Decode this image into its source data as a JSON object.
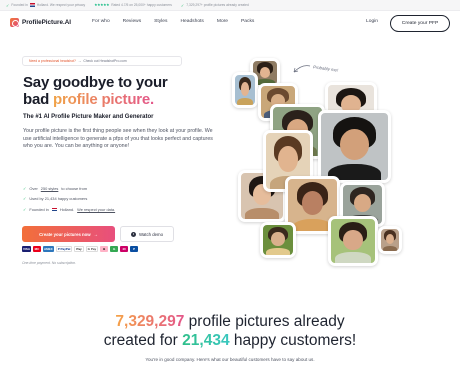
{
  "topbar": {
    "founded": "Founded in",
    "country": "Holland. We respect your privacy",
    "rating": "Rated 4.7/5 on 25,000+ happy customers",
    "created": "7,329,297+ profile pictures already created"
  },
  "nav": {
    "logo": "ProfilePicture.AI",
    "links": [
      "For who",
      "Reviews",
      "Styles",
      "Headshots",
      "More",
      "Packs"
    ],
    "login": "Login",
    "cta": "Create your PFP"
  },
  "banner": {
    "highlight": "Need a professional headshot?",
    "rest": "Check out HeadshotPro.com"
  },
  "hero": {
    "title_line1": "Say goodbye to your",
    "title_pre": "bad ",
    "title_grad": "profile picture.",
    "subtitle": "The #1 AI Profile Picture Maker and Generator",
    "paragraph": "Your profile picture is the first thing people see when they look at your profile. We use artificial intelligence to generate a pfps of you that looks perfect and captures who you are. You can be anything or anyone!"
  },
  "checks": {
    "c1_pre": "Over",
    "c1_link": "250 styles",
    "c1_post": "to choose from",
    "c2": "Used by 21,434 happy customers",
    "c3_pre": "Founded in",
    "c3_mid": "Holland.",
    "c3_link": "We respect your data."
  },
  "buttons": {
    "create": "Create your pictures now",
    "create_arrow": "→",
    "watch": "Watch demo"
  },
  "payments": [
    "VISA",
    "MC",
    "AMEX",
    "P PayPal",
    "Pay",
    "G Pay",
    "B",
    "G",
    "iD",
    "P"
  ],
  "note": "One-time payment. No subscription.",
  "collage": {
    "handwritten": "Probably me!"
  },
  "stats": {
    "count1": "7,329,297",
    "text1": " profile pictures already",
    "text2_pre": "created for ",
    "count2": "21,434",
    "text2_post": " happy customers!",
    "good_company": "You're in good company. Here's what our beautiful customers have to say about us."
  },
  "colors": {
    "accent_orange": "#f26f3a",
    "accent_pink": "#e84f7d",
    "accent_teal": "#2fbf8a",
    "trust_green": "#00b67a"
  }
}
